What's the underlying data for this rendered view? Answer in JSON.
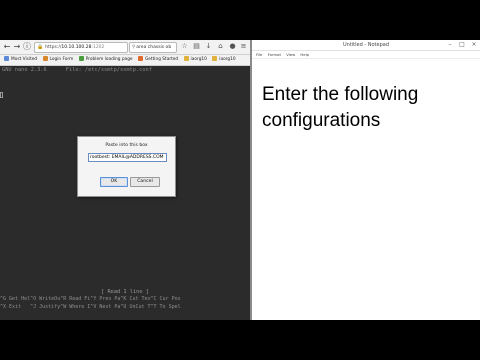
{
  "browser": {
    "url_host": "10.10.100.28",
    "url_port": ":1202",
    "search_text": "area chassis ob",
    "bookmarks": [
      {
        "label": "Most Visited",
        "color": "#5b8bd8"
      },
      {
        "label": "Login Form",
        "color": "#d8872a"
      },
      {
        "label": "Problem loading page",
        "color": "#4b9b3f"
      },
      {
        "label": "Getting Started",
        "color": "#e06a2a"
      },
      {
        "label": "iaorg10",
        "color": "#e0b23a"
      },
      {
        "label": "iaorg10",
        "color": "#e0b23a"
      }
    ]
  },
  "terminal": {
    "header": "GNU nano 2.3.6      File: /etc/ssmtp/ssmtp.conf",
    "status": "[ Read 1 line ]",
    "help_row1": "^G Get Hel^O WriteOu^R Read Fi^Y Prev Pa^K Cut Tex^C Cur Pos",
    "help_row2": "^X Exit   ^J Justify^W Where I^V Next Pa^U UnCut T^T To Spel"
  },
  "dialog": {
    "message": "Paste into this box",
    "input_value": "rootbest: EMAIL@ADDRESS.COM",
    "ok_label": "OK",
    "cancel_label": "Cancel"
  },
  "notepad": {
    "title": "Untitled - Notepad",
    "menu": [
      "File",
      "Format",
      "View",
      "Help"
    ],
    "line1": "Enter the following",
    "line2": "configurations"
  }
}
